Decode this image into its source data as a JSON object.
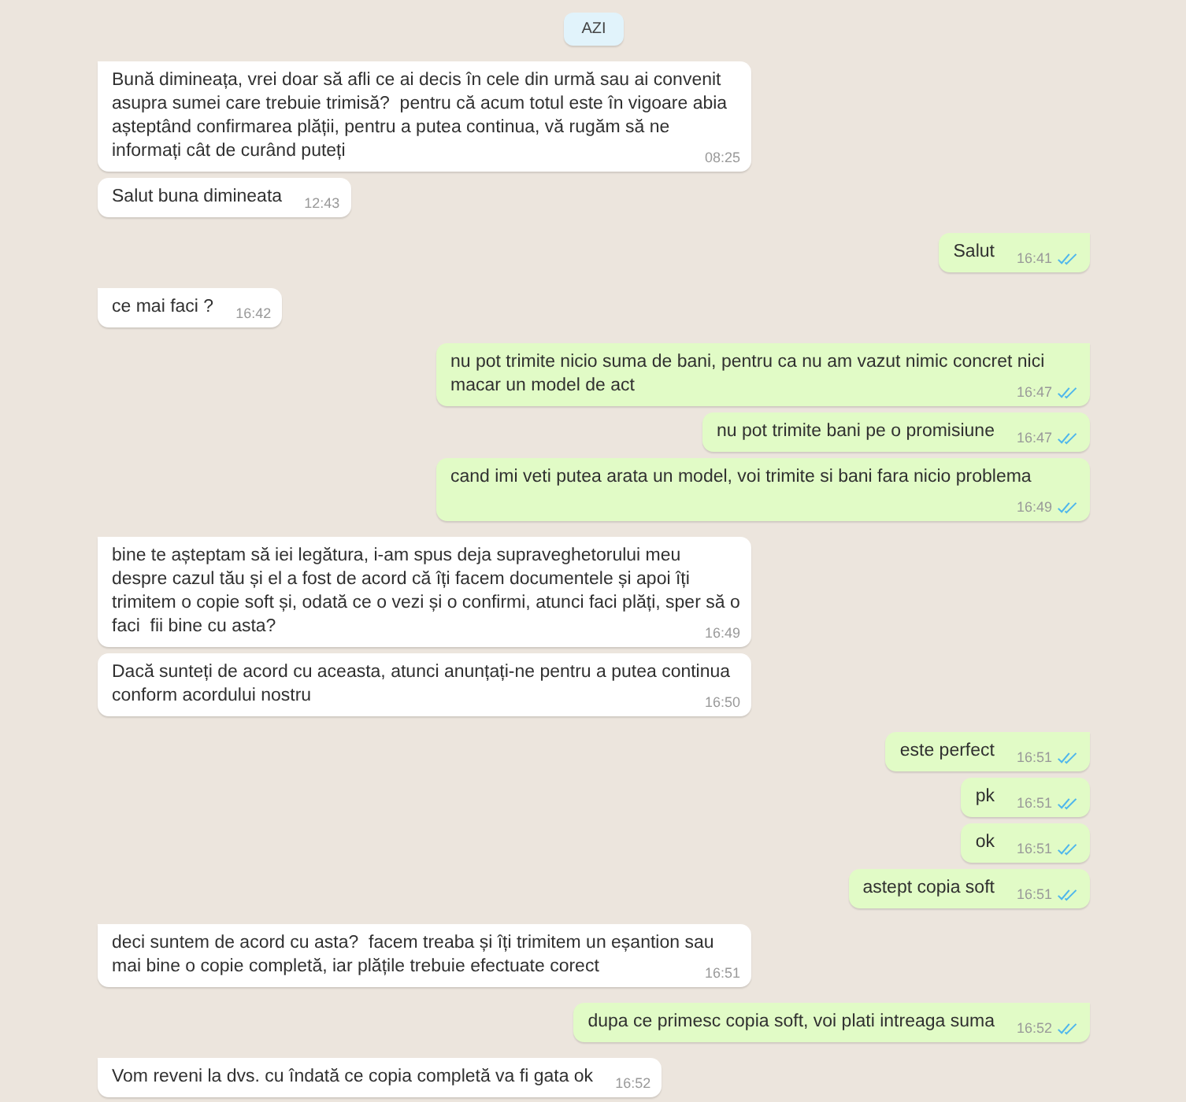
{
  "date_divider": "AZI",
  "messages": [
    {
      "kind": "incoming",
      "group_start": true,
      "text": "Bună dimineața, vrei doar să afli ce ai decis în cele din urmă sau ai convenit asupra sumei care trebuie trimisă?  pentru că acum totul este în vigoare abia așteptând confirmarea plății, pentru a putea continua, vă rugăm să ne informați cât de curând puteți",
      "time": "08:25"
    },
    {
      "kind": "incoming",
      "group_start": false,
      "text": "Salut buna dimineata",
      "time": "12:43"
    },
    {
      "kind": "outgoing",
      "group_start": true,
      "text": "Salut",
      "time": "16:41",
      "read": true
    },
    {
      "kind": "incoming",
      "group_start": true,
      "text": "ce mai faci ?",
      "time": "16:42"
    },
    {
      "kind": "outgoing",
      "group_start": true,
      "text": "nu pot trimite nicio suma de bani, pentru ca nu am vazut nimic concret nici macar un model de act",
      "time": "16:47",
      "read": true
    },
    {
      "kind": "outgoing",
      "group_start": false,
      "text": "nu pot trimite bani pe o promisiune",
      "time": "16:47",
      "read": true
    },
    {
      "kind": "outgoing",
      "group_start": false,
      "text": "cand imi veti putea arata un model, voi trimite si bani fara nicio problema",
      "time": "16:49",
      "read": true
    },
    {
      "kind": "incoming",
      "group_start": true,
      "text": "bine te așteptam să iei legătura, i-am spus deja supraveghetorului meu despre cazul tău și el a fost de acord că îți facem documentele și apoi îți trimitem o copie soft și, odată ce o vezi și o confirmi, atunci faci plăți, sper să o faci  fii bine cu asta?",
      "time": "16:49"
    },
    {
      "kind": "incoming",
      "group_start": false,
      "text": "Dacă sunteți de acord cu aceasta, atunci anunțați-ne pentru a putea continua conform acordului nostru",
      "time": "16:50"
    },
    {
      "kind": "outgoing",
      "group_start": true,
      "text": "este perfect",
      "time": "16:51",
      "read": true
    },
    {
      "kind": "outgoing",
      "group_start": false,
      "text": "pk",
      "time": "16:51",
      "read": true
    },
    {
      "kind": "outgoing",
      "group_start": false,
      "text": "ok",
      "time": "16:51",
      "read": true
    },
    {
      "kind": "outgoing",
      "group_start": false,
      "text": "astept copia soft",
      "time": "16:51",
      "read": true
    },
    {
      "kind": "incoming",
      "group_start": true,
      "text": "deci suntem de acord cu asta?  facem treaba și îți trimitem un eșantion sau mai bine o copie completă, iar plățile trebuie efectuate corect",
      "time": "16:51"
    },
    {
      "kind": "outgoing",
      "group_start": true,
      "text": "dupa ce primesc copia soft, voi plati intreaga suma",
      "time": "16:52",
      "read": true
    },
    {
      "kind": "incoming",
      "group_start": true,
      "text": "Vom reveni la dvs. cu îndată ce copia completă va fi gata ok",
      "time": "16:52"
    }
  ]
}
